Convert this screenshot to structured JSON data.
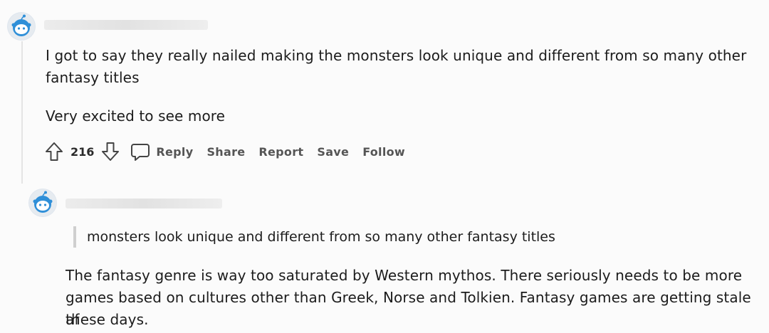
{
  "comment1": {
    "body_line1": "I got to say they really nailed making the monsters look unique and different from so many other",
    "body_line2": "fantasy titles",
    "body_para2": "Very excited to see more",
    "vote_count": "216",
    "actions": {
      "reply": "Reply",
      "share": "Share",
      "report": "Report",
      "save": "Save",
      "follow": "Follow"
    }
  },
  "comment2": {
    "quote": "monsters look unique and different from so many other fantasy titles",
    "body_line1": "The fantasy genre is way too saturated by Western mythos. There seriously needs to be more",
    "body_line2": "games based on cultures other than Greek, Norse and Tolkien. Fantasy games are getting stale af",
    "body_line3": "these days."
  },
  "icons": {
    "avatar": "reddit-snoo-avatar-icon",
    "upvote": "arrow-up-outline-icon",
    "downvote": "arrow-down-outline-icon",
    "reply": "speech-bubble-icon"
  },
  "colors": {
    "background": "#fbfbfb",
    "text": "#1c1c1c",
    "action_text": "#555555",
    "avatar_blue": "#2f8fd8"
  }
}
